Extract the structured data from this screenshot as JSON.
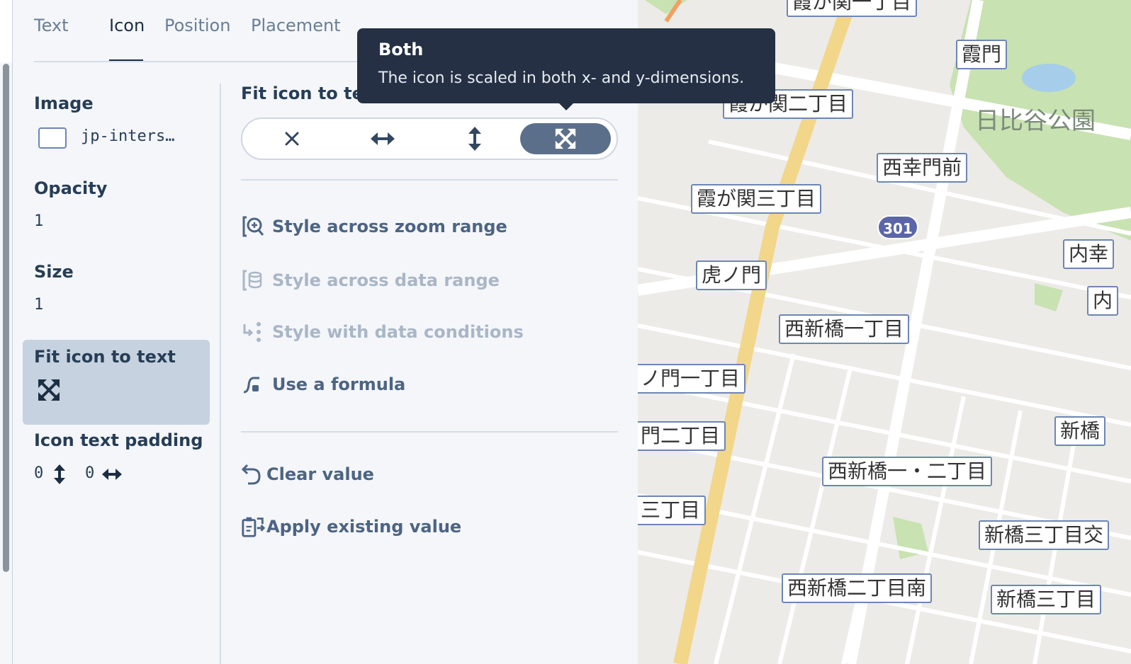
{
  "tabs": [
    {
      "label": "Text"
    },
    {
      "label": "Icon"
    },
    {
      "label": "Position"
    },
    {
      "label": "Placement"
    }
  ],
  "properties": {
    "image": {
      "label": "Image",
      "value": "jp-inters…"
    },
    "opacity": {
      "label": "Opacity",
      "value": "1"
    },
    "size": {
      "label": "Size",
      "value": "1"
    },
    "fit": {
      "label": "Fit icon to text"
    },
    "padding": {
      "label": "Icon text padding",
      "vertical": "0",
      "horizontal": "0"
    }
  },
  "editor": {
    "title": "Fit icon to tex",
    "options": [
      "none",
      "width",
      "height",
      "both"
    ],
    "selected": "both"
  },
  "actions": {
    "zoom": {
      "label": "Style across zoom range"
    },
    "data_range": {
      "label": "Style across data range"
    },
    "conditions": {
      "label": "Style with data conditions"
    },
    "formula": {
      "label": "Use a formula"
    },
    "clear": {
      "label": "Clear value"
    },
    "apply": {
      "label": "Apply existing value"
    }
  },
  "tooltip": {
    "title": "Both",
    "body": "The icon is scaled in both x- and y-dimensions."
  },
  "map": {
    "labels": [
      "霞が関一丁目",
      "霞門",
      "日比谷公園",
      "霞が関二丁目",
      "西幸門前",
      "霞が関三丁目",
      "内幸",
      "虎ノ門",
      "内",
      "西新橋一丁目",
      "ノ門一丁目",
      "新橋",
      "門二丁目",
      "西新橋一・二丁目",
      "三丁目",
      "新橋三丁目交",
      "西新橋二丁目南",
      "新橋三丁目"
    ],
    "route_shield": "301"
  },
  "colors": {
    "panel_bg": "#f4f6fa",
    "accent": "#5c6f8a",
    "tooltip_bg": "#253044",
    "selected_bg": "#c6d2df",
    "map_label_border": "#6d86b4"
  }
}
